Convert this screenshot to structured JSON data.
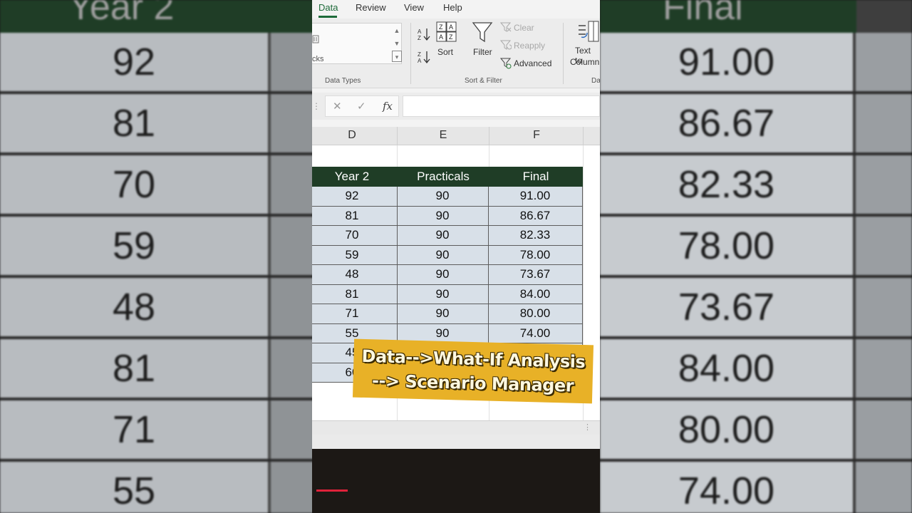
{
  "ribbon": {
    "tabs": [
      "Data",
      "Review",
      "View",
      "Help"
    ],
    "active_tab": "Data",
    "data_types_stub": "cks",
    "data_types_label": "Data Types",
    "sort_label": "Sort",
    "filter_label": "Filter",
    "clear_label": "Clear",
    "reapply_label": "Reapply",
    "advanced_label": "Advanced",
    "sort_filter_label": "Sort & Filter",
    "text_to_columns_label_1": "Text to",
    "text_to_columns_label_2": "Column",
    "next_group_stub": "Da"
  },
  "formula_bar": {
    "cancel": "✕",
    "enter": "✓",
    "fx": "fx"
  },
  "columns": [
    "D",
    "E",
    "F"
  ],
  "table": {
    "headers": [
      "Year 2",
      "Practicals",
      "Final"
    ],
    "rows": [
      [
        "92",
        "90",
        "91.00"
      ],
      [
        "81",
        "90",
        "86.67"
      ],
      [
        "70",
        "90",
        "82.33"
      ],
      [
        "59",
        "90",
        "78.00"
      ],
      [
        "48",
        "90",
        "73.67"
      ],
      [
        "81",
        "90",
        "84.00"
      ],
      [
        "71",
        "90",
        "80.00"
      ],
      [
        "55",
        "90",
        "74.00"
      ],
      [
        "45",
        "",
        ""
      ],
      [
        "60",
        "",
        ""
      ]
    ]
  },
  "caption": {
    "line1": "Data-->What-If Analysis",
    "line2": "--> Scenario Manager"
  },
  "background": {
    "left_header": "Year 2",
    "right_header": "Final",
    "left_values": [
      "92",
      "81",
      "70",
      "59",
      "48",
      "81",
      "71",
      "55"
    ],
    "right_values": [
      "91.00",
      "86.67",
      "82.33",
      "78.00",
      "73.67",
      "84.00",
      "80.00",
      "74.00"
    ]
  },
  "colors": {
    "header_green": "#1f3d26",
    "row_fill": "#d8e0e8",
    "caption_bg": "#e8b127",
    "progress_red": "#e0223a"
  }
}
